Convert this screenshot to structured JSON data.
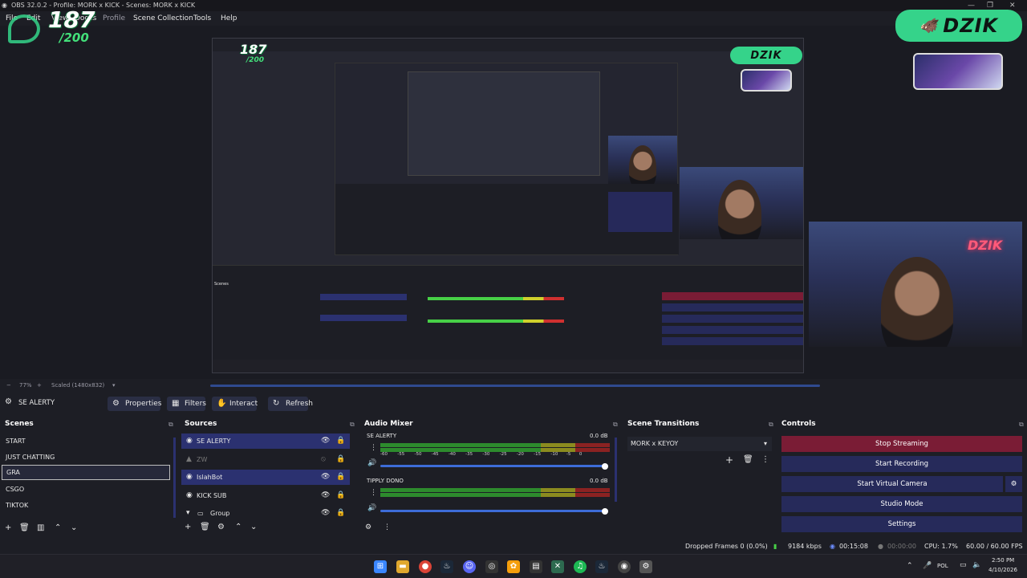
{
  "window": {
    "title": "OBS 32.0.2 - Profile: MORK x KICK - Scenes: MORK x KICK",
    "controls": [
      "—",
      "❐",
      "✕"
    ]
  },
  "menu": [
    "File",
    "Edit",
    "View",
    "Docks",
    "Profile",
    "Scene Collection",
    "Tools",
    "Help"
  ],
  "overlay": {
    "counter": "187",
    "goal": "/200",
    "brand": "DZIK"
  },
  "preview": {
    "zoom": "77%",
    "scale": "Scaled (1480x832)"
  },
  "source_toolbar": {
    "current_source": "SE ALERTY",
    "buttons": [
      "Properties",
      "Filters",
      "Interact",
      "Refresh"
    ]
  },
  "scenes": {
    "title": "Scenes",
    "items": [
      "START",
      "JUST CHATTING",
      "GRA",
      "CSGO",
      "TIKTOK"
    ],
    "selected": "GRA"
  },
  "sources": {
    "title": "Sources",
    "items": [
      {
        "name": "SE ALERTY",
        "highlight": true
      },
      {
        "name": "ZW",
        "highlight": false
      },
      {
        "name": "IslahBot",
        "highlight": true
      },
      {
        "name": "KICK SUB",
        "highlight": false
      },
      {
        "name": "Group",
        "highlight": false
      }
    ]
  },
  "audio_mixer": {
    "title": "Audio Mixer",
    "channels": [
      {
        "name": "SE ALERTY",
        "level": "0.0 dB"
      },
      {
        "name": "TIPPLY DONO",
        "level": "0.0 dB"
      }
    ],
    "scale": [
      "-60",
      "-55",
      "-50",
      "-45",
      "-40",
      "-35",
      "-30",
      "-25",
      "-20",
      "-15",
      "-10",
      "-5",
      "0"
    ]
  },
  "scene_transitions": {
    "title": "Scene Transitions",
    "selected": "MORK x KEYOY"
  },
  "controls": {
    "title": "Controls",
    "buttons": [
      "Stop Streaming",
      "Start Recording",
      "Start Virtual Camera",
      "Studio Mode",
      "Settings"
    ]
  },
  "status": {
    "dropped_frames": "Dropped Frames 0 (0.0%)",
    "bitrate": "9184 kbps",
    "stream_time": "00:15:08",
    "rec_time": "00:00:00",
    "cpu": "CPU: 1.7%",
    "fps": "60.00 / 60.00 FPS"
  },
  "taskbar": {
    "lang": "POL",
    "time": "2:50 PM",
    "date": "4/10/2026"
  },
  "colors": {
    "accent_blue": "#2b3170",
    "stop_red": "#7a1c35",
    "brand_green": "#35d38a"
  }
}
